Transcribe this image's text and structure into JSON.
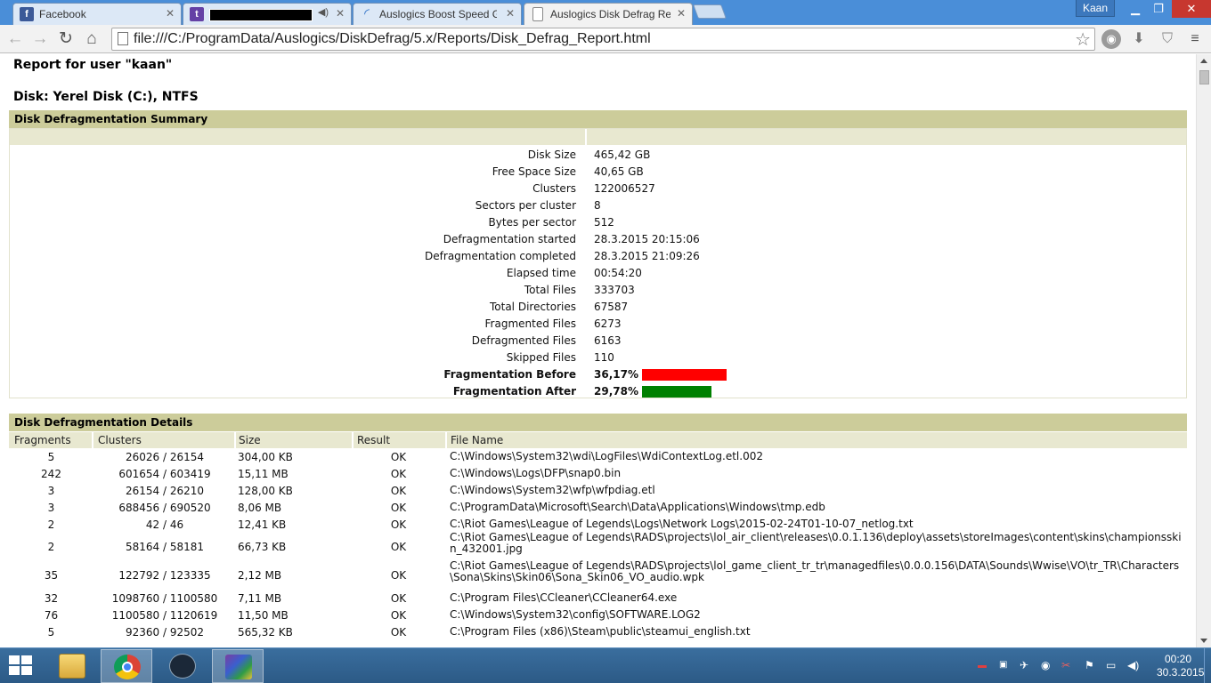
{
  "browser": {
    "tabs": [
      {
        "title": "Facebook",
        "icon": "facebook-icon",
        "color": "#3b5998"
      },
      {
        "title": "",
        "icon": "twitch-icon",
        "color": "#6441a5",
        "redacted": true
      },
      {
        "title": "Auslogics Boost Speed Gu",
        "icon": "loading-icon",
        "color": "#4a8ed8"
      },
      {
        "title": "Auslogics Disk Defrag Rep",
        "icon": "page-icon",
        "color": "#ffffff"
      }
    ],
    "profile_name": "Kaan",
    "address": "file:///C:/ProgramData/Auslogics/DiskDefrag/5.x/Reports/Disk_Defrag_Report.html"
  },
  "report": {
    "user_heading": "Report for user \"kaan\"",
    "disk_heading": "Disk: Yerel Disk (C:), NTFS",
    "summary_title": "Disk Defragmentation Summary",
    "summary": [
      {
        "label": "Disk Size",
        "value": "465,42 GB"
      },
      {
        "label": "Free Space Size",
        "value": "40,65 GB"
      },
      {
        "label": "Clusters",
        "value": "122006527"
      },
      {
        "label": "Sectors per cluster",
        "value": "8"
      },
      {
        "label": "Bytes per sector",
        "value": "512"
      },
      {
        "label": "Defragmentation started",
        "value": "28.3.2015 20:15:06"
      },
      {
        "label": "Defragmentation completed",
        "value": "28.3.2015 21:09:26"
      },
      {
        "label": "Elapsed time",
        "value": "00:54:20"
      },
      {
        "label": "Total Files",
        "value": "333703"
      },
      {
        "label": "Total Directories",
        "value": "67587"
      },
      {
        "label": "Fragmented Files",
        "value": "6273"
      },
      {
        "label": "Defragmented Files",
        "value": "6163"
      },
      {
        "label": "Skipped Files",
        "value": "110"
      }
    ],
    "fragmentation": [
      {
        "label": "Fragmentation Before",
        "value": "36,17%",
        "percent": 36.17,
        "color": "#ff0000"
      },
      {
        "label": "Fragmentation After",
        "value": "29,78%",
        "percent": 29.78,
        "color": "#008000"
      }
    ],
    "details_title": "Disk Defragmentation Details",
    "details_columns": [
      "Fragments",
      "Clusters",
      "Size",
      "Result",
      "File Name"
    ],
    "details_rows": [
      {
        "fragments": "5",
        "clusters": "26026 / 26154",
        "size": "304,00 KB",
        "result": "OK",
        "file": "C:\\Windows\\System32\\wdi\\LogFiles\\WdiContextLog.etl.002"
      },
      {
        "fragments": "242",
        "clusters": "601654 / 603419",
        "size": "15,11 MB",
        "result": "OK",
        "file": "C:\\Windows\\Logs\\DFP\\snap0.bin"
      },
      {
        "fragments": "3",
        "clusters": "26154 / 26210",
        "size": "128,00 KB",
        "result": "OK",
        "file": "C:\\Windows\\System32\\wfp\\wfpdiag.etl"
      },
      {
        "fragments": "3",
        "clusters": "688456 / 690520",
        "size": "8,06 MB",
        "result": "OK",
        "file": "C:\\ProgramData\\Microsoft\\Search\\Data\\Applications\\Windows\\tmp.edb"
      },
      {
        "fragments": "2",
        "clusters": "42 / 46",
        "size": "12,41 KB",
        "result": "OK",
        "file": "C:\\Riot Games\\League of Legends\\Logs\\Network Logs\\2015-02-24T01-10-07_netlog.txt"
      },
      {
        "fragments": "2",
        "clusters": "58164 / 58181",
        "size": "66,73 KB",
        "result": "OK",
        "file": "C:\\Riot Games\\League of Legends\\RADS\\projects\\lol_air_client\\releases\\0.0.1.136\\deploy\\assets\\storeImages\\content\\skins\\championsskin_432001.jpg"
      },
      {
        "fragments": "35",
        "clusters": "122792 / 123335",
        "size": "2,12 MB",
        "result": "OK",
        "file": "C:\\Riot Games\\League of Legends\\RADS\\projects\\lol_game_client_tr_tr\\managedfiles\\0.0.0.156\\DATA\\Sounds\\Wwise\\VO\\tr_TR\\Characters\\Sona\\Skins\\Skin06\\Sona_Skin06_VO_audio.wpk"
      },
      {
        "fragments": "32",
        "clusters": "1098760 / 1100580",
        "size": "7,11 MB",
        "result": "OK",
        "file": "C:\\Program Files\\CCleaner\\CCleaner64.exe"
      },
      {
        "fragments": "76",
        "clusters": "1100580 / 1120619",
        "size": "11,50 MB",
        "result": "OK",
        "file": "C:\\Windows\\System32\\config\\SOFTWARE.LOG2"
      },
      {
        "fragments": "5",
        "clusters": "92360 / 92502",
        "size": "565,32 KB",
        "result": "OK",
        "file": "C:\\Program Files (x86)\\Steam\\public\\steamui_english.txt"
      }
    ]
  },
  "taskbar": {
    "apps": [
      "file-explorer-icon",
      "chrome-icon",
      "steam-icon",
      "winrar-icon"
    ],
    "time": "00:20",
    "date": "30.3.2015"
  }
}
